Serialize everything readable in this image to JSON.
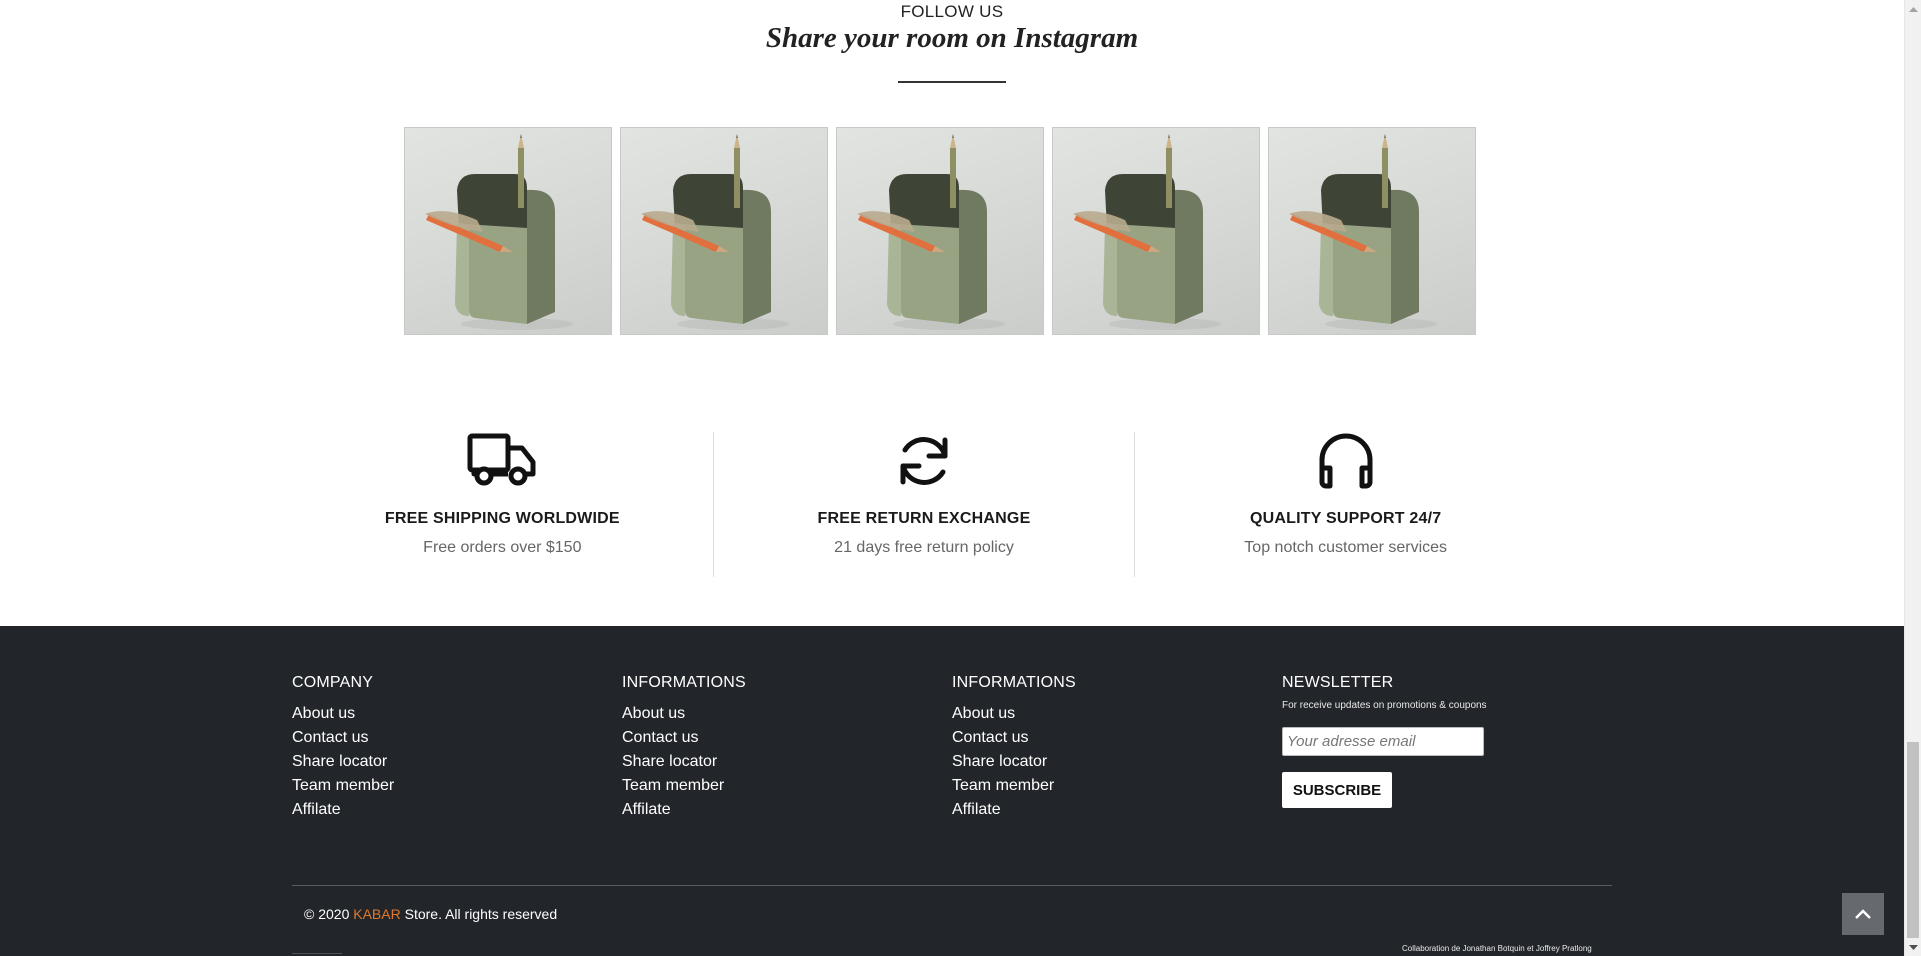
{
  "instagram": {
    "follow_label": "FOLLOW US",
    "title": "Share your room on Instagram",
    "photos": [
      "pencil-holder-photo",
      "pencil-holder-photo",
      "pencil-holder-photo",
      "pencil-holder-photo",
      "pencil-holder-photo"
    ]
  },
  "features": [
    {
      "icon": "truck-icon",
      "title": "FREE SHIPPING WORLDWIDE",
      "text": "Free orders over $150"
    },
    {
      "icon": "refresh-icon",
      "title": "FREE RETURN EXCHANGE",
      "text": "21 days free return policy"
    },
    {
      "icon": "headphones-icon",
      "title": "QUALITY SUPPORT 24/7",
      "text": "Top notch customer services"
    }
  ],
  "footer": {
    "columns": [
      {
        "heading": "COMPANY",
        "links": [
          "About us",
          "Contact us",
          "Share locator",
          "Team member",
          "Affilate"
        ]
      },
      {
        "heading": "INFORMATIONS",
        "links": [
          "About us",
          "Contact us",
          "Share locator",
          "Team member",
          "Affilate"
        ]
      },
      {
        "heading": "INFORMATIONS",
        "links": [
          "About us",
          "Contact us",
          "Share locator",
          "Team member",
          "Affilate"
        ]
      }
    ],
    "newsletter": {
      "heading": "NEWSLETTER",
      "note": "For receive updates on promotions & coupons",
      "placeholder": "Your adresse email",
      "button": "SUBSCRIBE"
    },
    "copyright_prefix": "© 2020",
    "brand": "KABAR",
    "copyright_suffix": "Store. All rights reserved",
    "credit": "Collaboration de Jonathan Botquin et Joffrey Pratlong"
  },
  "colors": {
    "footer_bg": "#22252a",
    "brand_accent": "#e0792f",
    "back_to_top_bg": "#666a6f"
  }
}
